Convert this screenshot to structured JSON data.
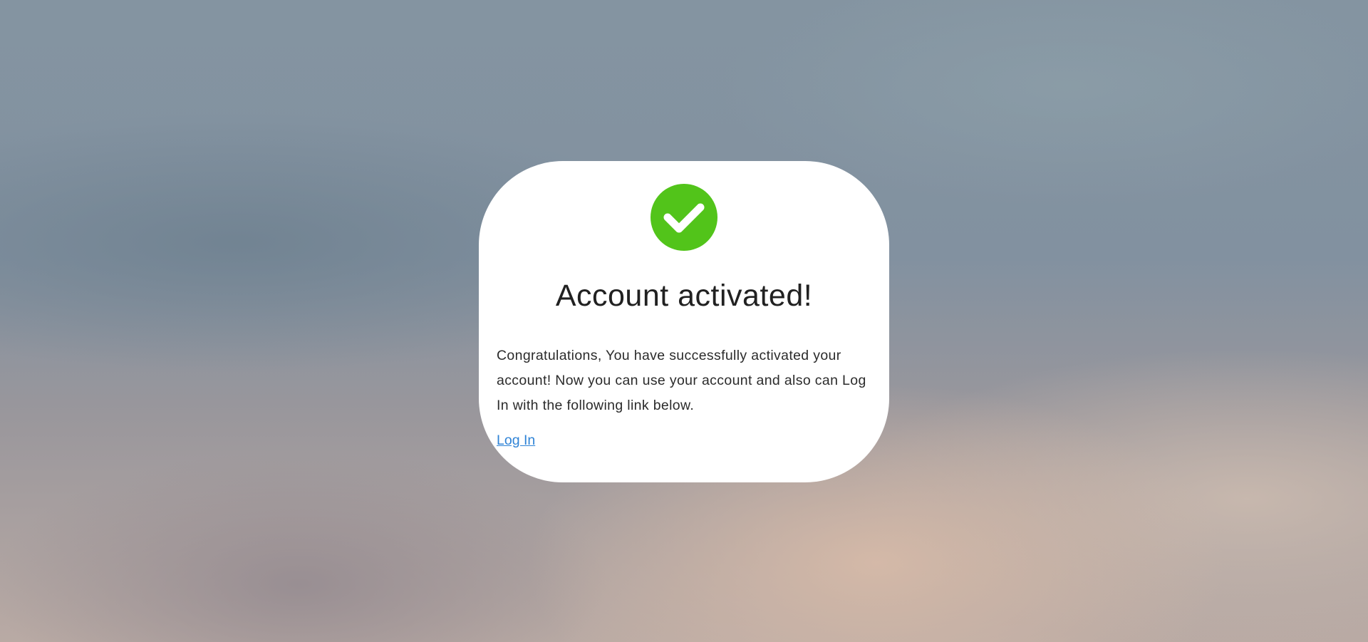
{
  "card": {
    "icon": "check-circle-icon",
    "icon_color": "#52c41a",
    "title": "Account activated!",
    "message": "Congratulations, You have successfully activated your account! Now you can use your account and also can Log In with the following link below.",
    "login_link": "Log In",
    "link_color": "#2f83d6"
  }
}
